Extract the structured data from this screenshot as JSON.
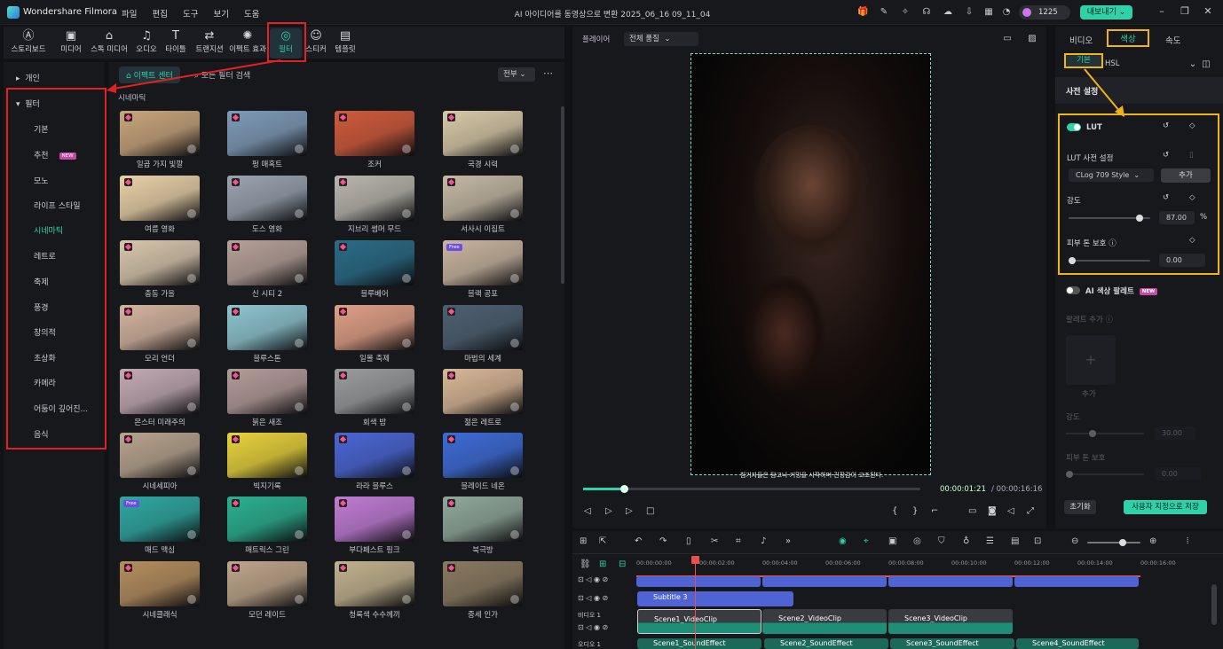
{
  "titlebar": {
    "app_name": "Wondershare Filmora",
    "menus": [
      "파일",
      "편집",
      "도구",
      "보기",
      "도움"
    ],
    "window_title": "AI 아이디어를 동영상으로 변환 2025_06_16 09_11_04",
    "credits": "1225",
    "export_label": "내보내기"
  },
  "toolbar": {
    "tools": [
      {
        "label": "스토리보드",
        "icon": "storyboard-icon"
      },
      {
        "label": "미디어",
        "icon": "media-icon"
      },
      {
        "label": "스톡 미디어",
        "icon": "stock-media-icon"
      },
      {
        "label": "오디오",
        "icon": "audio-icon"
      },
      {
        "label": "타이틀",
        "icon": "title-icon"
      },
      {
        "label": "트랜지션",
        "icon": "transition-icon"
      },
      {
        "label": "이펙트 효과",
        "icon": "effects-icon"
      },
      {
        "label": "필터",
        "icon": "filter-icon"
      },
      {
        "label": "스티커",
        "icon": "sticker-icon"
      },
      {
        "label": "템플릿",
        "icon": "template-icon"
      }
    ]
  },
  "sidebar": {
    "personal": "개인",
    "filters": "필터",
    "items": [
      "기본",
      "추천",
      "모노",
      "라이프 스타일",
      "시네마틱",
      "레트로",
      "축제",
      "풍경",
      "창의적",
      "초상화",
      "카메라",
      "어둠이 깊어진...",
      "음식"
    ],
    "new_badge": "NEW",
    "active": "시네마틱"
  },
  "grid": {
    "segment_on": "이펙트 센터",
    "segment_off": "모든 필터 검색",
    "sort_label": "전부",
    "section_title": "시네마틱",
    "free_label": "Free",
    "cards": [
      [
        "일곱 가지 빛깔",
        "펑 매혹트",
        "조커",
        "국경 시력"
      ],
      [
        "여름 영화",
        "도스 영화",
        "지브리 썸머 무드",
        "서사시 이집트"
      ],
      [
        "충동 가을",
        "신 시티 2",
        "블루베어",
        "블랙 공포"
      ],
      [
        "모리 언더",
        "블루스톤",
        "일몰 축제",
        "마법의 세계"
      ],
      [
        "몬스터 미래주의",
        "붉은 새조",
        "회색 밤",
        "젊은 레트로"
      ],
      [
        "시네세피아",
        "빅지기록",
        "라라 블루스",
        "블레이드 네온"
      ],
      [
        "매드 맥심",
        "매트릭스 그린",
        "부다페스트 핑크",
        "북극방"
      ],
      [
        "시네클래식",
        "모던 레이드",
        "청록색 수수께끼",
        "중세 인가"
      ]
    ]
  },
  "player": {
    "label": "플레이어",
    "quality": "전체 품질",
    "subtitle": "침거자들은 탐고나 커밍을 시작하며 긴장감이 고조된다.",
    "current_time": "00:00:01:21",
    "total_time": "/ 00:00:16:16",
    "progress_fraction": 0.12
  },
  "inspector": {
    "tabs": [
      "비디오",
      "색상",
      "속도"
    ],
    "sub_basic": "기본",
    "sub_hsl": "HSL",
    "preset_title": "사전 설정",
    "lut_label": "LUT",
    "lut_preset_label": "LUT 사전 설정",
    "lut_select": "CLog 709 Style",
    "add_label": "추가",
    "strength_label": "강도",
    "strength_value": "87.00",
    "strength_unit": "%",
    "strength_fraction": 0.87,
    "skin_label": "피부 톤 보호",
    "skin_value": "0.00",
    "ai_palette_label": "AI 색상 팔레트",
    "new_badge": "NEW",
    "add_palette_label": "팔레트 추가",
    "add_caption": "추가",
    "dim_strength_label": "강도",
    "dim_strength_value": "30.00",
    "dim_skin_label": "피부 톤 보호",
    "dim_skin_value": "0.00",
    "reset_label": "초기화",
    "save_custom_label": "사용자 지정으로 저장"
  },
  "timeline": {
    "ticks": [
      "00:00:00:00",
      "00:00:02:00",
      "00:00:04:00",
      "00:00:06:00",
      "00:00:08:00",
      "00:00:10:00",
      "00:00:12:00",
      "00:00:14:00",
      "00:00:16:00"
    ],
    "video_track_label": "비디오 1",
    "audio_track_label": "오디오 1",
    "subtitle_clip": "Subtitle 3",
    "video_clips": [
      "Scene1_VideoClip",
      "Scene2_VideoClip",
      "Scene3_VideoClip"
    ],
    "audio_clips": [
      "Scene1_SoundEffect",
      "Scene2_SoundEffect",
      "Scene3_SoundEffect",
      "Scene4_SoundEffect"
    ]
  },
  "colors": {
    "accent": "#2fd1a6",
    "highlight_box": "#f2b31a",
    "annotation_red": "#e02222"
  }
}
